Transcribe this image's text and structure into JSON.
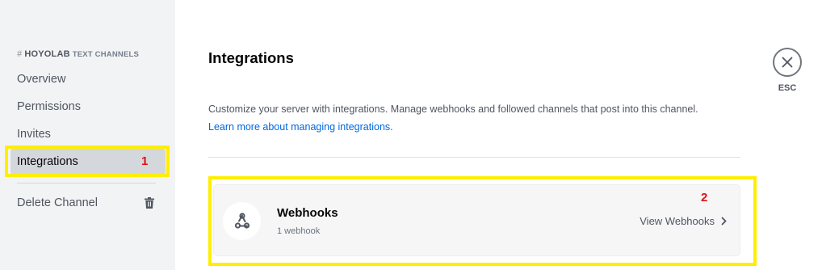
{
  "sidebar": {
    "channel_header": {
      "hash": "#",
      "name": "HOYOLAB",
      "suffix": "TEXT CHANNELS"
    },
    "items": [
      {
        "label": "Overview",
        "selected": false
      },
      {
        "label": "Permissions",
        "selected": false
      },
      {
        "label": "Invites",
        "selected": false
      },
      {
        "label": "Integrations",
        "selected": true
      }
    ],
    "delete_item": {
      "label": "Delete Channel",
      "icon": "trash-icon"
    }
  },
  "main": {
    "title": "Integrations",
    "description": "Customize your server with integrations. Manage webhooks and followed channels that post into this channel.",
    "learn_more_link": "Learn more about managing integrations.",
    "webhooks_card": {
      "icon": "webhook-icon",
      "title": "Webhooks",
      "subtitle": "1 webhook",
      "action_label": "View Webhooks",
      "action_icon": "chevron-right-icon"
    }
  },
  "close": {
    "icon": "close-icon",
    "label": "ESC"
  },
  "annotations": [
    {
      "number": "1",
      "color": "#ffee00",
      "number_color": "#e01010"
    },
    {
      "number": "2",
      "color": "#ffee00",
      "number_color": "#e01010"
    }
  ]
}
